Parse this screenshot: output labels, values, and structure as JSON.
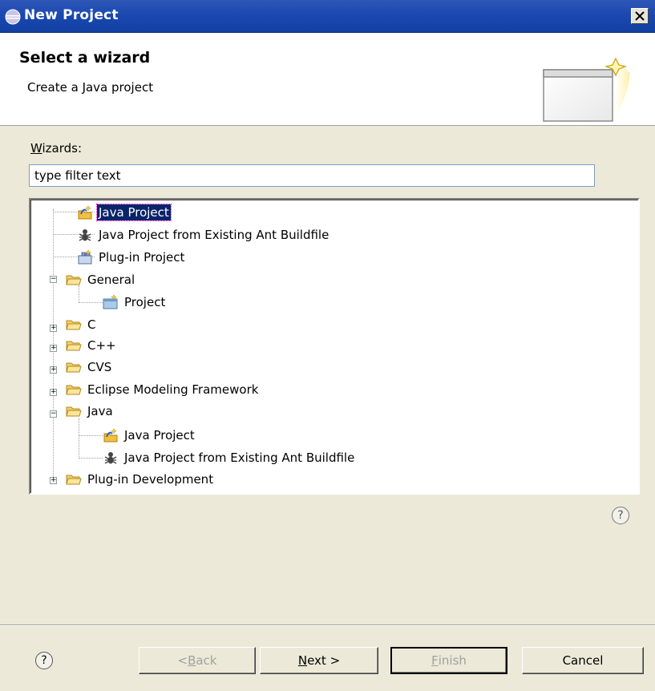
{
  "window": {
    "title": "New Project",
    "close_label": "×"
  },
  "banner": {
    "title": "Select a wizard",
    "description": "Create a Java project"
  },
  "wizards": {
    "label_rest": "izards:",
    "label_mnemonic": "W",
    "filter_value": "type filter text"
  },
  "tree": {
    "items": [
      {
        "label": "Java Project",
        "icon": "java-project-icon",
        "selected": true
      },
      {
        "label": "Java Project from Existing Ant Buildfile",
        "icon": "ant-icon"
      },
      {
        "label": "Plug-in Project",
        "icon": "plugin-project-icon"
      },
      {
        "label": "General",
        "icon": "folder-open-icon",
        "expanded": true
      },
      {
        "label": "Project",
        "icon": "project-icon"
      },
      {
        "label": "C",
        "icon": "folder-icon"
      },
      {
        "label": "C++",
        "icon": "folder-icon"
      },
      {
        "label": "CVS",
        "icon": "folder-icon"
      },
      {
        "label": "Eclipse Modeling Framework",
        "icon": "folder-icon"
      },
      {
        "label": "Java",
        "icon": "folder-open-icon",
        "expanded": true
      },
      {
        "label": "Java Project",
        "icon": "java-project-icon"
      },
      {
        "label": "Java Project from Existing Ant Buildfile",
        "icon": "ant-icon"
      },
      {
        "label": "Plug-in Development",
        "icon": "folder-icon"
      }
    ]
  },
  "buttons": {
    "help": "?",
    "back_pre": "< ",
    "back_mn": "B",
    "back_post": "ack",
    "next_mn": "N",
    "next_post": "ext >",
    "finish_mn": "F",
    "finish_post": "inish",
    "cancel": "Cancel"
  },
  "colors": {
    "titlebar": "#1a48b0",
    "selection": "#0a246a",
    "dialog_bg": "#ece9d8"
  }
}
